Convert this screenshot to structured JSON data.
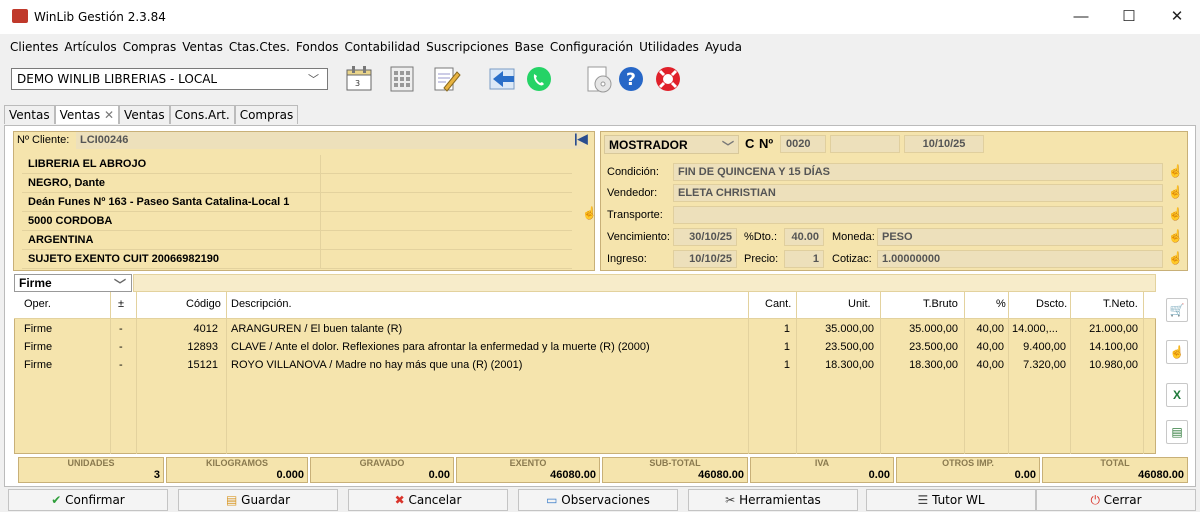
{
  "window": {
    "title": "WinLib Gestión 2.3.84",
    "min": "—",
    "max": "☐",
    "close": "✕"
  },
  "menu": [
    "Clientes",
    "Artículos",
    "Compras",
    "Ventas",
    "Ctas.Ctes.",
    "Fondos",
    "Contabilidad",
    "Suscripciones",
    "Base",
    "Configuración",
    "Utilidades",
    "Ayuda"
  ],
  "database": "DEMO WINLIB LIBRERIAS - LOCAL",
  "tabs": [
    "Ventas",
    "Ventas",
    "Ventas",
    "Cons.Art.",
    "Compras"
  ],
  "tab_close": "✕",
  "client": {
    "label": "Nº Cliente:",
    "code": "LCI00246",
    "lines": [
      "LIBRERIA EL ABROJO",
      "NEGRO, Dante",
      "Deán Funes Nº 163 - Paseo Santa Catalina-Local 1",
      "5000 CORDOBA",
      "ARGENTINA",
      "SUJETO EXENTO  CUIT 20066982190"
    ]
  },
  "invoice": {
    "point": "MOSTRADOR",
    "type": "C",
    "num_label": "Nº",
    "number": "0020",
    "date": "10/10/25"
  },
  "details": {
    "condicion_label": "Condición:",
    "condicion": "FIN DE QUINCENA Y 15 DÍAS",
    "vendedor_label": "Vendedor:",
    "vendedor": "ELETA CHRISTIAN",
    "transporte_label": "Transporte:",
    "transporte": "",
    "venc_label": "Vencimiento:",
    "venc": "30/10/25",
    "dto_label": "%Dto.:",
    "dto": "40.00",
    "moneda_label": "Moneda:",
    "moneda": "PESO",
    "ingreso_label": "Ingreso:",
    "ingreso": "10/10/25",
    "precio_label": "Precio:",
    "precio": "1",
    "cotiz_label": "Cotizac:",
    "cotiz": "1.00000000"
  },
  "filter": "Firme",
  "table": {
    "headers": [
      "Oper.",
      "±",
      "Código",
      "Descripción.",
      "Cant.",
      "Unit.",
      "T.Bruto",
      "%",
      "Dscto.",
      "T.Neto."
    ],
    "rows": [
      [
        "Firme",
        "-",
        "4012",
        "ARANGUREN / El buen talante (R)",
        "1",
        "35.000,00",
        "35.000,00",
        "40,00",
        "14.000,...",
        "21.000,00"
      ],
      [
        "Firme",
        "-",
        "12893",
        "CLAVE / Ante el dolor. Reflexiones para afrontar la enfermedad y la muerte (R) (2000)",
        "1",
        "23.500,00",
        "23.500,00",
        "40,00",
        "9.400,00",
        "14.100,00"
      ],
      [
        "Firme",
        "-",
        "15121",
        "ROYO VILLANOVA / Madre no hay más que una (R) (2001)",
        "1",
        "18.300,00",
        "18.300,00",
        "40,00",
        "7.320,00",
        "10.980,00"
      ]
    ]
  },
  "totals": [
    {
      "label": "UNIDADES",
      "value": "3"
    },
    {
      "label": "KILOGRAMOS",
      "value": "0.000"
    },
    {
      "label": "GRAVADO",
      "value": "0.00"
    },
    {
      "label": "EXENTO",
      "value": "46080.00"
    },
    {
      "label": "SUB-TOTAL",
      "value": "46080.00"
    },
    {
      "label": "IVA",
      "value": "0.00"
    },
    {
      "label": "OTROS IMP.",
      "value": "0.00"
    },
    {
      "label": "TOTAL",
      "value": "46080.00"
    }
  ],
  "buttons": [
    "Confirmar",
    "Guardar",
    "Cancelar",
    "Observaciones",
    "Herramientas",
    "Tutor WL",
    "Cerrar"
  ],
  "colors": {
    "panel": "#f5e4ad",
    "field": "#ede0bb",
    "accent_green": "#2e9e3a",
    "accent_red": "#d9342b"
  }
}
